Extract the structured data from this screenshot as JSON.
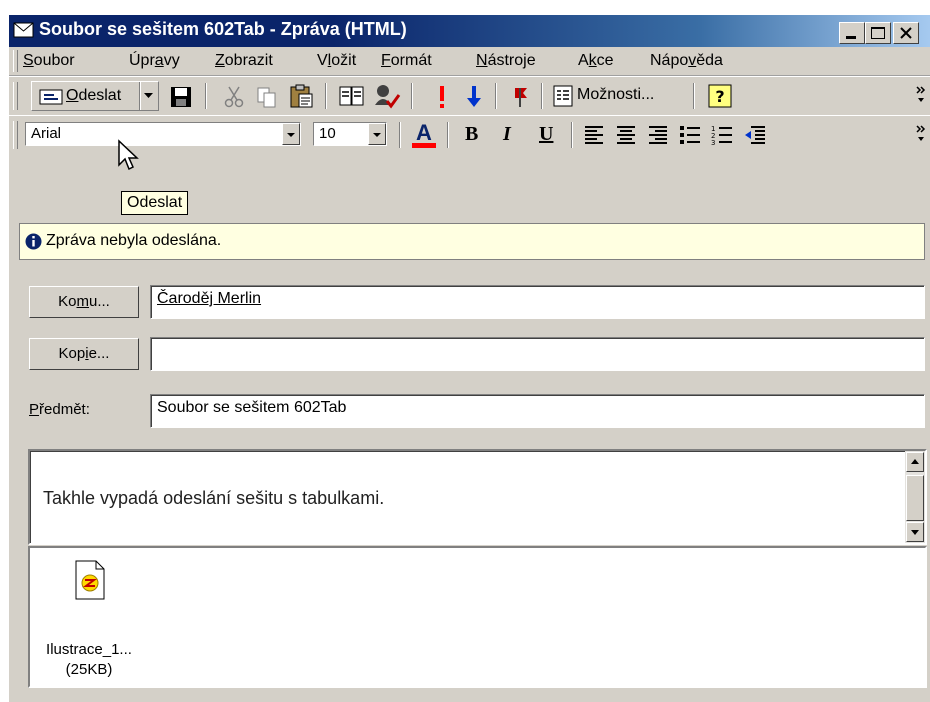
{
  "window": {
    "title": "Soubor se sešitem 602Tab - Zpráva (HTML)"
  },
  "menu": {
    "items": [
      {
        "pre": "",
        "key": "S",
        "post": "oubor"
      },
      {
        "pre": "Úpr",
        "key": "a",
        "post": "vy"
      },
      {
        "pre": "",
        "key": "Z",
        "post": "obrazit"
      },
      {
        "pre": "V",
        "key": "l",
        "post": "ožit"
      },
      {
        "pre": "",
        "key": "F",
        "post": "ormát"
      },
      {
        "pre": "",
        "key": "N",
        "post": "ástroje"
      },
      {
        "pre": "A",
        "key": "k",
        "post": "ce"
      },
      {
        "pre": "Nápo",
        "key": "v",
        "post": "ěda"
      }
    ]
  },
  "toolbar": {
    "send": {
      "pre": "",
      "key": "O",
      "post": "deslat"
    },
    "options_label": "Možnosti...",
    "options_key": "ž"
  },
  "format": {
    "font": "Arial",
    "size": "10",
    "bold": "B",
    "italic": "I",
    "underline": "U"
  },
  "tooltip": "Odeslat",
  "info_bar": "Zpráva nebyla odeslána.",
  "to_button": {
    "pre": "Ko",
    "key": "m",
    "post": "u..."
  },
  "to_value": "Čaroděj Merlin",
  "cc_button": {
    "pre": "Kop",
    "key": "i",
    "post": "e..."
  },
  "cc_value": "",
  "subject_label": {
    "pre": "",
    "key": "P",
    "post": "ředmět:"
  },
  "subject_value": "Soubor se sešitem 602Tab",
  "body_text": "Takhle vypadá odeslání sešitu s tabulkami.",
  "attachment": {
    "name": "Ilustrace_1...",
    "size": "(25KB)"
  },
  "colors": {
    "title_start": "#0a246a",
    "title_end": "#a6caf0",
    "info_bg": "#ffffe1",
    "font_color_bar": "#ff0000"
  }
}
